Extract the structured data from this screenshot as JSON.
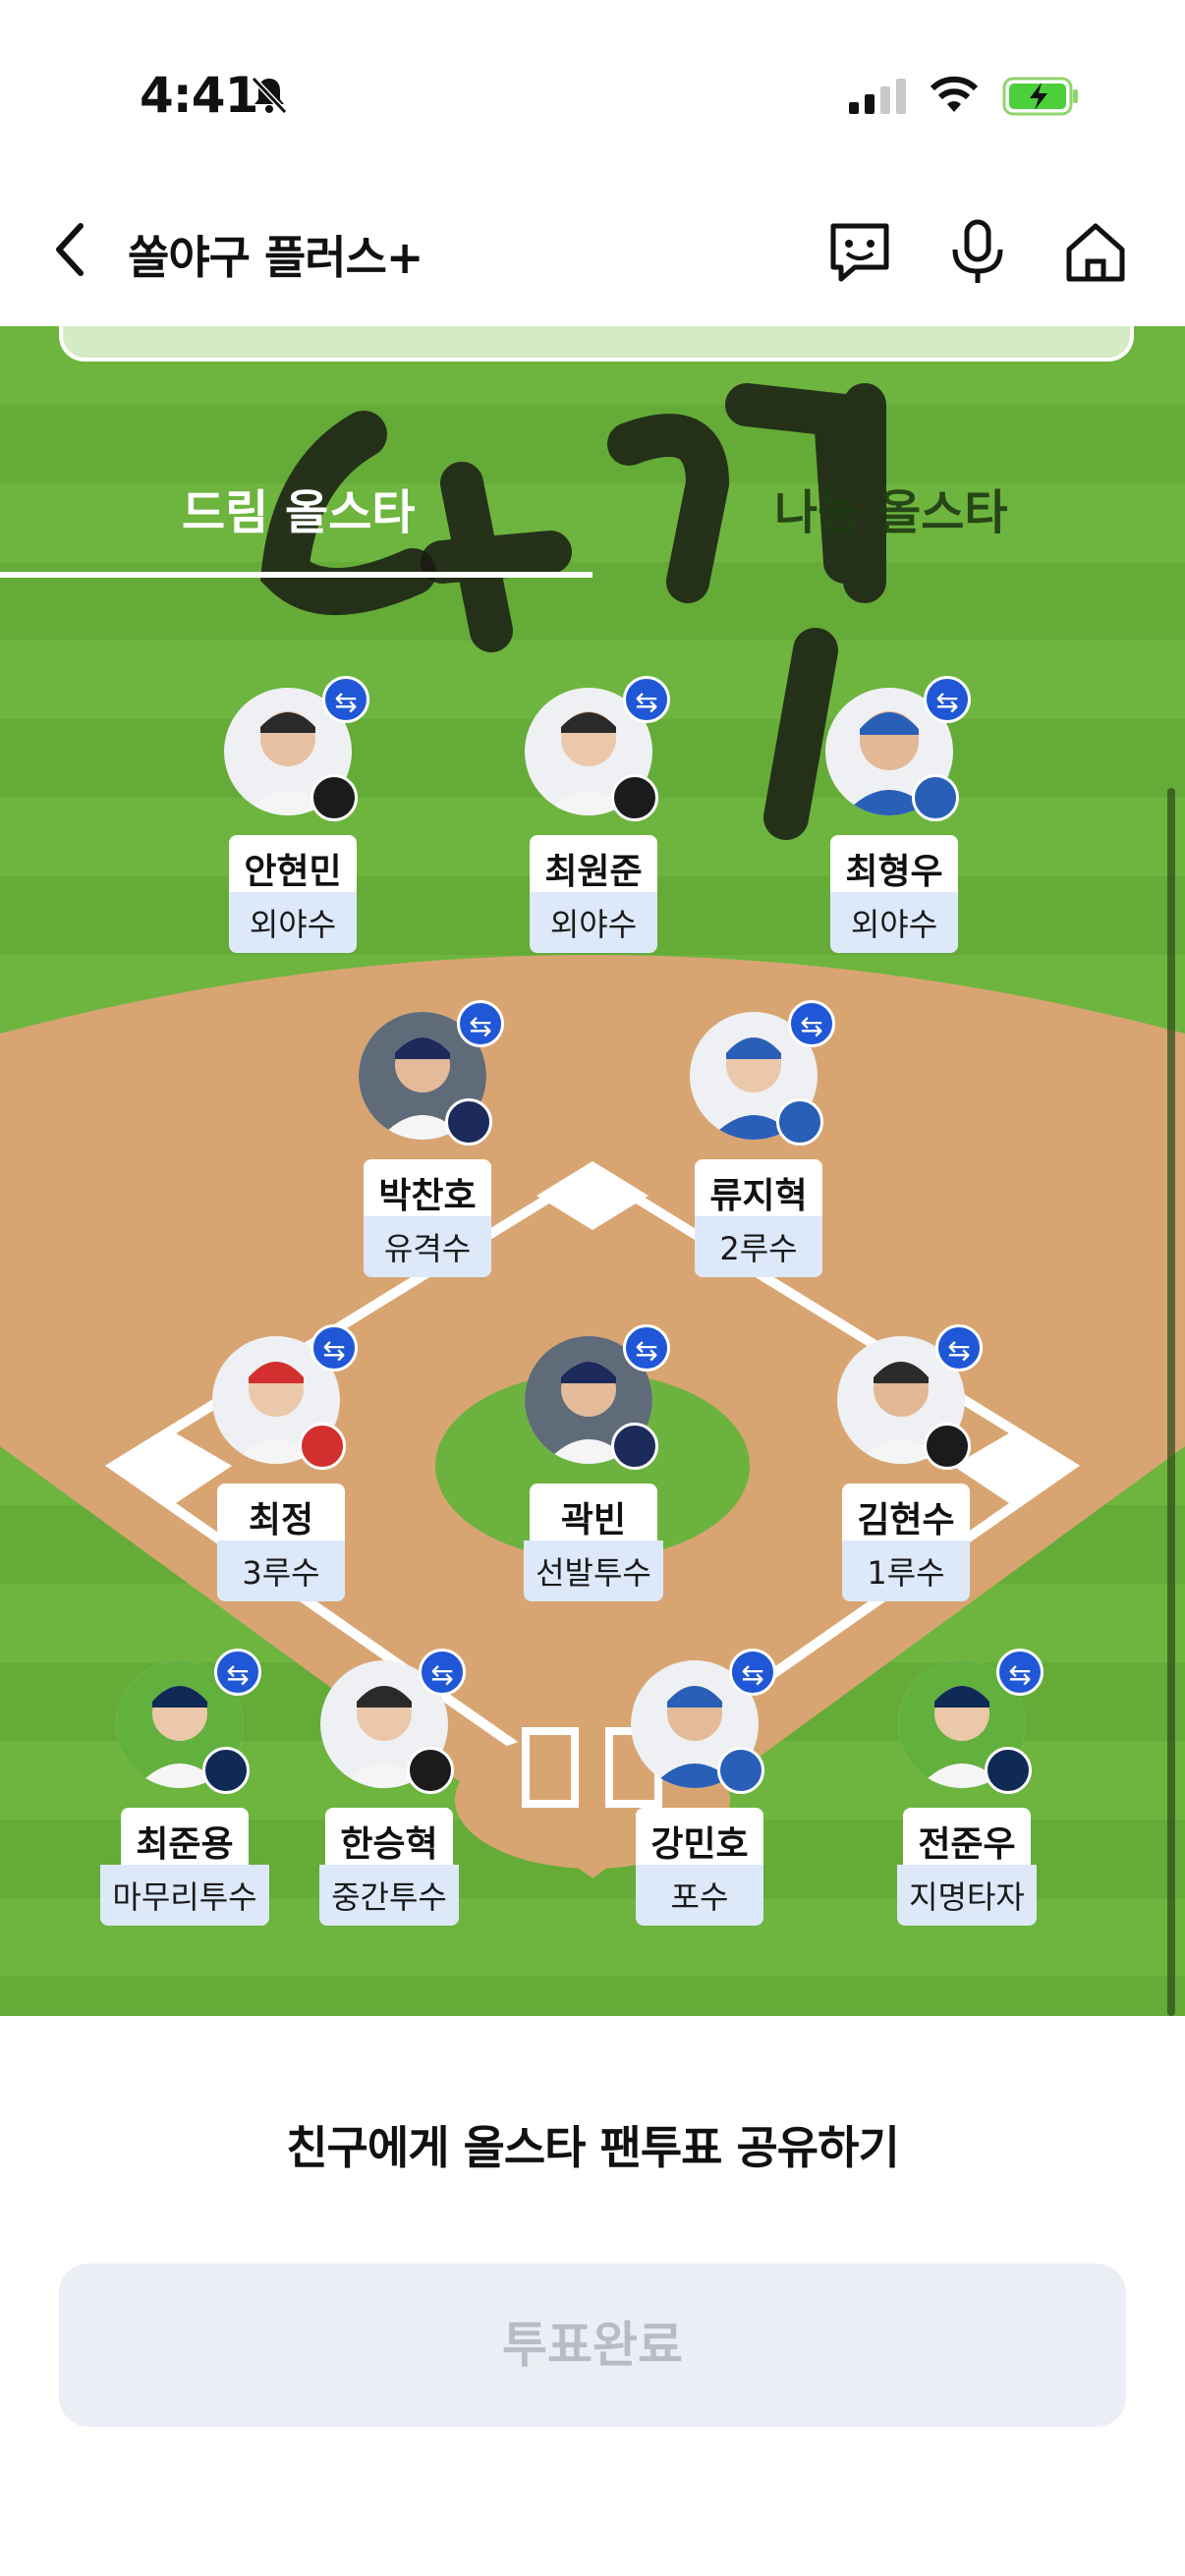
{
  "status_bar": {
    "time": "4:41"
  },
  "header": {
    "title": "쏠야구 플러스+"
  },
  "tabs": [
    {
      "label": "드림 올스타",
      "active": true
    },
    {
      "label": "나눔 올스타",
      "active": false
    }
  ],
  "players": [
    {
      "name": "안현민",
      "position": "외야수",
      "team_color": "#1b1b1b"
    },
    {
      "name": "최원준",
      "position": "외야수",
      "team_color": "#1b1b1b"
    },
    {
      "name": "최형우",
      "position": "외야수",
      "team_color": "#2a5fb8"
    },
    {
      "name": "박찬호",
      "position": "유격수",
      "team_color": "#1c2a5c"
    },
    {
      "name": "류지혁",
      "position": "2루수",
      "team_color": "#2a5fb8"
    },
    {
      "name": "최정",
      "position": "3루수",
      "team_color": "#d32f2f"
    },
    {
      "name": "곽빈",
      "position": "선발투수",
      "team_color": "#1c2a5c"
    },
    {
      "name": "김현수",
      "position": "1루수",
      "team_color": "#1b1b1b"
    },
    {
      "name": "최준용",
      "position": "마무리투수",
      "team_color": "#0f2a55"
    },
    {
      "name": "한승혁",
      "position": "중간투수",
      "team_color": "#1b1b1b"
    },
    {
      "name": "강민호",
      "position": "포수",
      "team_color": "#2a5fb8"
    },
    {
      "name": "전준우",
      "position": "지명타자",
      "team_color": "#0f2a55"
    }
  ],
  "share_text": "친구에게 올스타 팬투표 공유하기",
  "vote_button": "투표완료",
  "colors": {
    "field_green": "#6bb33e",
    "dirt": "#d8a572",
    "swap_blue": "#1f57d6",
    "position_bg": "#dde8f9"
  }
}
